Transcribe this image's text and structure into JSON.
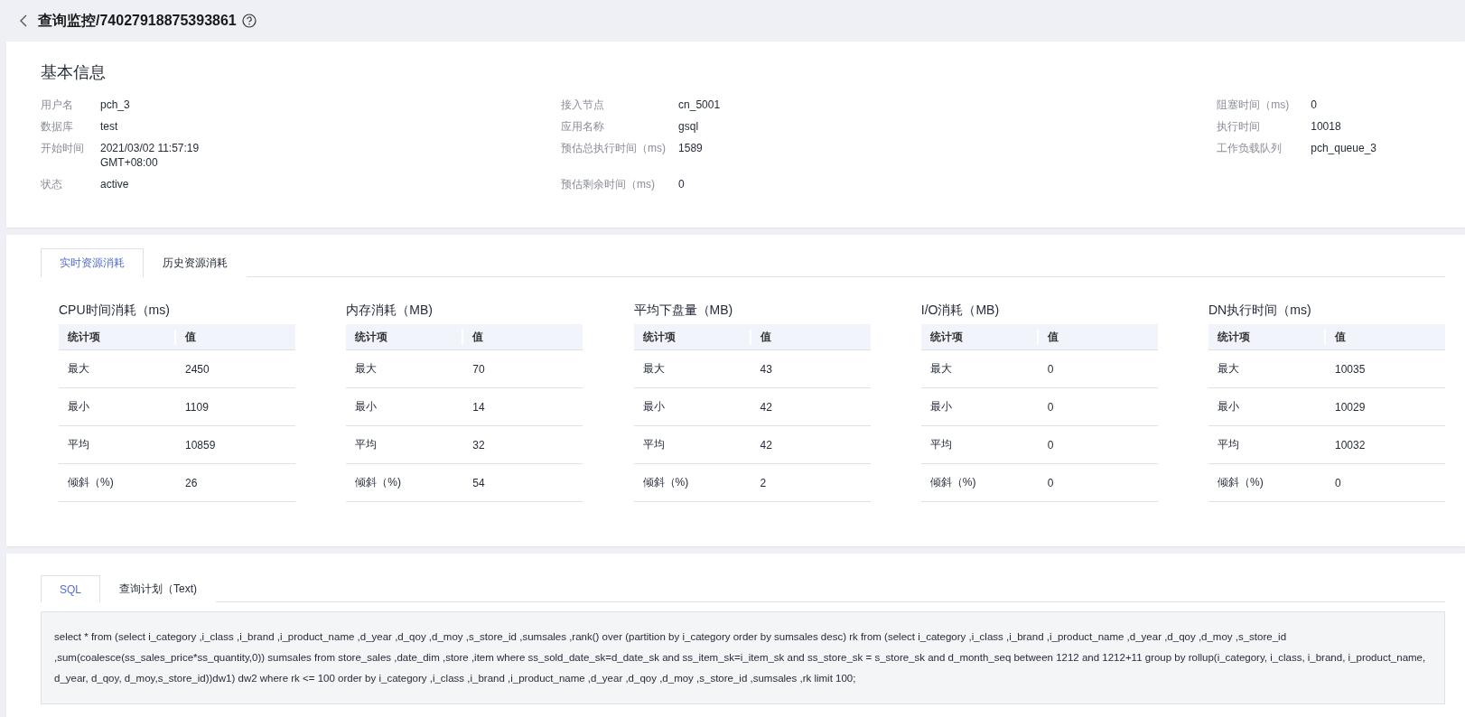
{
  "header": {
    "title": "查询监控/74027918875393861"
  },
  "basic_info": {
    "title": "基本信息",
    "columns": [
      [
        {
          "label": "用户名",
          "value": "pch_3"
        },
        {
          "label": "数据库",
          "value": "test"
        },
        {
          "label": "开始时间",
          "value": "2021/03/02 11:57:19 GMT+08:00"
        },
        {
          "label": "状态",
          "value": "active"
        }
      ],
      [
        {
          "label": "接入节点",
          "value": "cn_5001"
        },
        {
          "label": "应用名称",
          "value": "gsql"
        },
        {
          "label": "预估总执行时间（ms)",
          "value": "1589"
        },
        {
          "label": "预估剩余时间（ms)",
          "value": "0"
        }
      ],
      [
        {
          "label": "阻塞时间（ms)",
          "value": "0"
        },
        {
          "label": "执行时间",
          "value": "10018"
        },
        {
          "label": "工作负载队列",
          "value": "pch_queue_3"
        }
      ]
    ]
  },
  "resource_tabs": [
    {
      "label": "实时资源消耗",
      "selected": true
    },
    {
      "label": "历史资源消耗",
      "selected": false
    }
  ],
  "resource_tables": [
    {
      "title": "CPU时间消耗（ms)",
      "columns": [
        "统计项",
        "值"
      ],
      "rows": [
        [
          "最大",
          "2450"
        ],
        [
          "最小",
          "1109"
        ],
        [
          "平均",
          "10859"
        ],
        [
          "倾斜（%)",
          "26"
        ]
      ]
    },
    {
      "title": "内存消耗（MB)",
      "columns": [
        "统计项",
        "值"
      ],
      "rows": [
        [
          "最大",
          "70"
        ],
        [
          "最小",
          "14"
        ],
        [
          "平均",
          "32"
        ],
        [
          "倾斜（%)",
          "54"
        ]
      ]
    },
    {
      "title": "平均下盘量（MB)",
      "columns": [
        "统计项",
        "值"
      ],
      "rows": [
        [
          "最大",
          "43"
        ],
        [
          "最小",
          "42"
        ],
        [
          "平均",
          "42"
        ],
        [
          "倾斜（%)",
          "2"
        ]
      ]
    },
    {
      "title": "I/O消耗（MB)",
      "columns": [
        "统计项",
        "值"
      ],
      "rows": [
        [
          "最大",
          "0"
        ],
        [
          "最小",
          "0"
        ],
        [
          "平均",
          "0"
        ],
        [
          "倾斜（%)",
          "0"
        ]
      ]
    },
    {
      "title": "DN执行时间（ms)",
      "columns": [
        "统计项",
        "值"
      ],
      "rows": [
        [
          "最大",
          "10035"
        ],
        [
          "最小",
          "10029"
        ],
        [
          "平均",
          "10032"
        ],
        [
          "倾斜（%)",
          "0"
        ]
      ]
    }
  ],
  "sql_tabs": [
    {
      "label": "SQL",
      "selected": true
    },
    {
      "label": "查询计划（Text)",
      "selected": false
    }
  ],
  "sql_text": "select * from (select i_category ,i_class ,i_brand ,i_product_name ,d_year ,d_qoy ,d_moy ,s_store_id ,sumsales ,rank() over (partition by i_category order by sumsales desc) rk from (select i_category ,i_class ,i_brand ,i_product_name ,d_year ,d_qoy ,d_moy ,s_store_id ,sum(coalesce(ss_sales_price*ss_quantity,0)) sumsales from store_sales ,date_dim ,store ,item where ss_sold_date_sk=d_date_sk and ss_item_sk=i_item_sk and ss_store_sk = s_store_sk and d_month_seq between 1212 and 1212+11 group by rollup(i_category, i_class, i_brand, i_product_name, d_year, d_qoy, d_moy,s_store_id))dw1) dw2 where rk <= 100 order by i_category ,i_class ,i_brand ,i_product_name ,d_year ,d_qoy ,d_moy ,s_store_id ,sumsales ,rk limit 100;"
}
